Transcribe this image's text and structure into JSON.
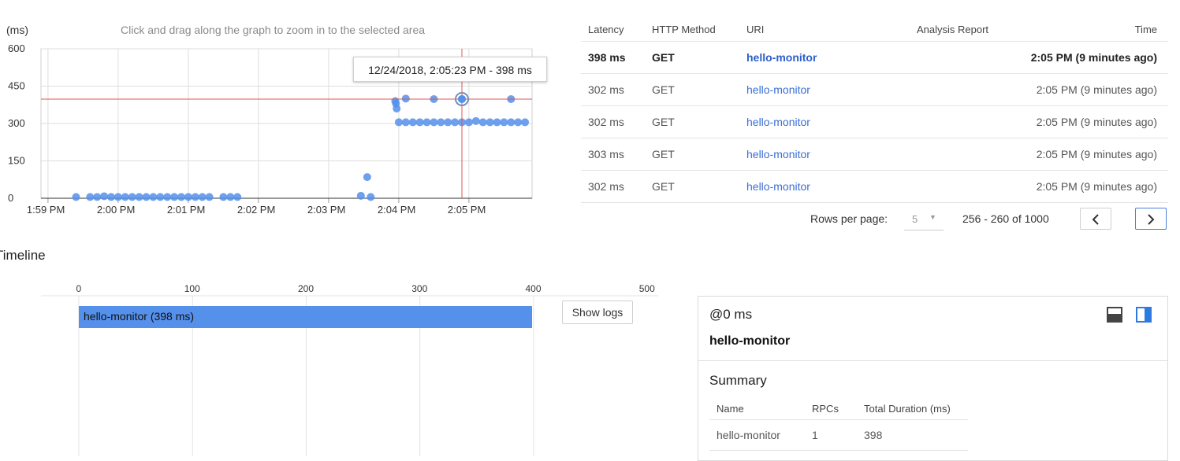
{
  "latency_chart": {
    "unit_label": "(ms)",
    "hint": "Click and drag along the graph to zoom in to the selected area",
    "tooltip": "12/24/2018, 2:05:23 PM - 398 ms",
    "accent_color": "#5590ea",
    "crosshair_color": "#e05555"
  },
  "chart_data": {
    "type": "scatter",
    "ylabel": "(ms)",
    "ylim": [
      0,
      600
    ],
    "y_ticks": [
      "0",
      "150",
      "300",
      "450",
      "600"
    ],
    "x_ticks": [
      "1:59 PM",
      "2:00 PM",
      "2:01 PM",
      "2:02 PM",
      "2:03 PM",
      "2:04 PM",
      "2:05 PM"
    ],
    "selected_point": {
      "x": "2:05:23 PM",
      "y": 398
    },
    "series": [
      {
        "points": [
          {
            "x": 1.4,
            "y": 5
          },
          {
            "x": 1.6,
            "y": 5
          },
          {
            "x": 1.7,
            "y": 5
          },
          {
            "x": 1.8,
            "y": 8
          },
          {
            "x": 1.9,
            "y": 5
          },
          {
            "x": 2.0,
            "y": 5
          },
          {
            "x": 2.1,
            "y": 5
          },
          {
            "x": 2.2,
            "y": 5
          },
          {
            "x": 2.3,
            "y": 5
          },
          {
            "x": 2.4,
            "y": 5
          },
          {
            "x": 2.5,
            "y": 5
          },
          {
            "x": 2.6,
            "y": 5
          },
          {
            "x": 2.7,
            "y": 5
          },
          {
            "x": 2.8,
            "y": 5
          },
          {
            "x": 2.9,
            "y": 5
          },
          {
            "x": 3.0,
            "y": 5
          },
          {
            "x": 3.1,
            "y": 5
          },
          {
            "x": 3.2,
            "y": 5
          },
          {
            "x": 3.3,
            "y": 5
          },
          {
            "x": 3.5,
            "y": 5
          },
          {
            "x": 3.6,
            "y": 5
          },
          {
            "x": 3.7,
            "y": 5
          },
          {
            "x": 5.46,
            "y": 10
          },
          {
            "x": 5.55,
            "y": 85
          },
          {
            "x": 5.6,
            "y": 5
          },
          {
            "x": 5.95,
            "y": 390
          },
          {
            "x": 5.96,
            "y": 380
          },
          {
            "x": 5.97,
            "y": 360
          },
          {
            "x": 6.1,
            "y": 400
          },
          {
            "x": 6.5,
            "y": 398
          },
          {
            "x": 6.9,
            "y": 398
          },
          {
            "x": 7.6,
            "y": 398
          },
          {
            "x": 6.0,
            "y": 305
          },
          {
            "x": 6.1,
            "y": 305
          },
          {
            "x": 6.2,
            "y": 305
          },
          {
            "x": 6.3,
            "y": 305
          },
          {
            "x": 6.4,
            "y": 305
          },
          {
            "x": 6.5,
            "y": 305
          },
          {
            "x": 6.6,
            "y": 305
          },
          {
            "x": 6.7,
            "y": 305
          },
          {
            "x": 6.8,
            "y": 305
          },
          {
            "x": 6.9,
            "y": 305
          },
          {
            "x": 7.0,
            "y": 305
          },
          {
            "x": 7.1,
            "y": 310
          },
          {
            "x": 7.2,
            "y": 305
          },
          {
            "x": 7.3,
            "y": 305
          },
          {
            "x": 7.4,
            "y": 305
          },
          {
            "x": 7.5,
            "y": 305
          },
          {
            "x": 7.6,
            "y": 305
          },
          {
            "x": 7.7,
            "y": 305
          },
          {
            "x": 7.8,
            "y": 305
          }
        ]
      }
    ]
  },
  "traces_table": {
    "headers": {
      "latency": "Latency",
      "method": "HTTP Method",
      "uri": "URI",
      "report": "Analysis Report",
      "time": "Time"
    },
    "rows": [
      {
        "latency": "398 ms",
        "method": "GET",
        "uri": "hello-monitor",
        "time": "2:05 PM  (9 minutes ago)"
      },
      {
        "latency": "302 ms",
        "method": "GET",
        "uri": "hello-monitor",
        "time": "2:05 PM  (9 minutes ago)"
      },
      {
        "latency": "302 ms",
        "method": "GET",
        "uri": "hello-monitor",
        "time": "2:05 PM  (9 minutes ago)"
      },
      {
        "latency": "303 ms",
        "method": "GET",
        "uri": "hello-monitor",
        "time": "2:05 PM  (9 minutes ago)"
      },
      {
        "latency": "302 ms",
        "method": "GET",
        "uri": "hello-monitor",
        "time": "2:05 PM  (9 minutes ago)"
      }
    ],
    "pagination": {
      "rows_per_page_label": "Rows per page:",
      "rows_per_page": "5",
      "range": "256 - 260 of 1000"
    }
  },
  "timeline": {
    "title": "Timeline",
    "axis_ticks": [
      "0",
      "100",
      "200",
      "300",
      "400",
      "500"
    ],
    "span_label": "hello-monitor (398 ms)",
    "show_logs": "Show logs"
  },
  "details": {
    "offset": "@0 ms",
    "name": "hello-monitor",
    "summary_title": "Summary",
    "summary_headers": {
      "name": "Name",
      "rpcs": "RPCs",
      "duration": "Total Duration (ms)"
    },
    "summary_rows": [
      {
        "name": "hello-monitor",
        "rpcs": "1",
        "duration": "398"
      }
    ]
  }
}
